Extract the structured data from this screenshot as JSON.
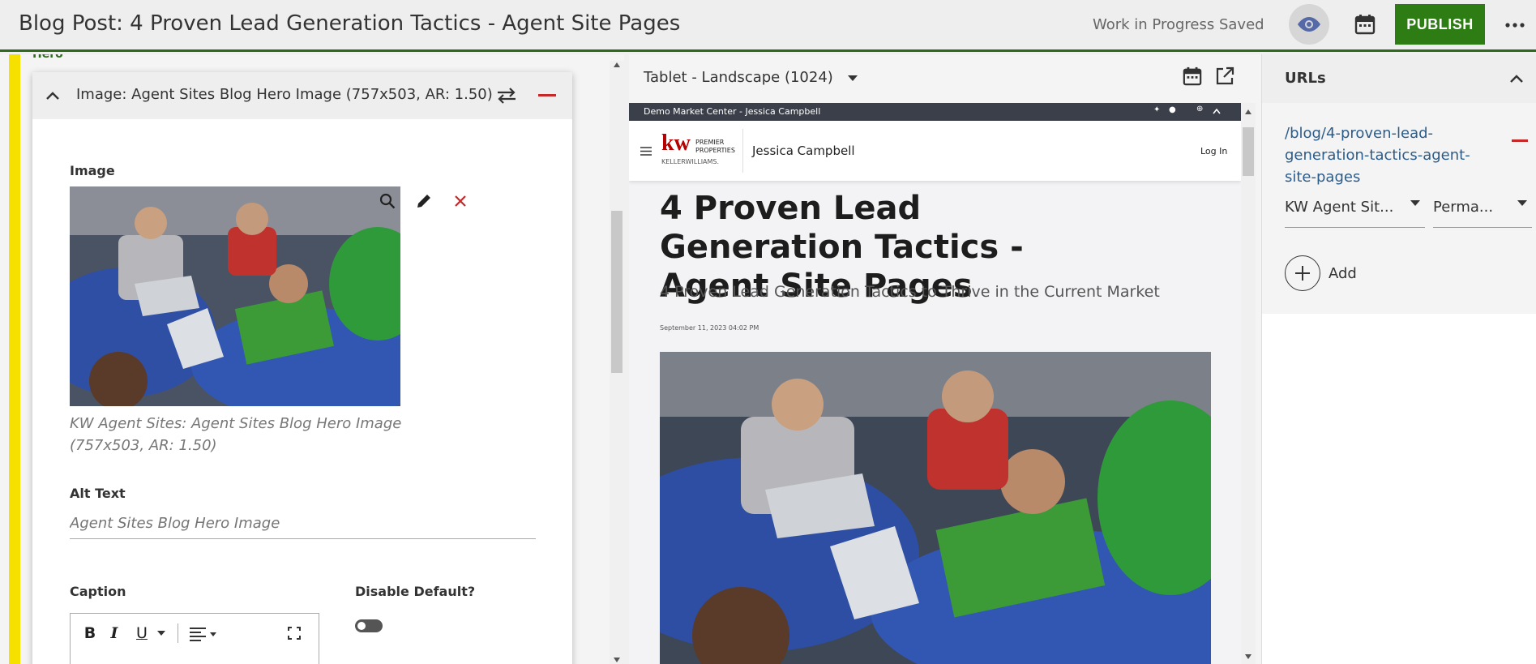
{
  "header": {
    "title": "Blog Post: 4 Proven Lead Generation Tactics - Agent Site Pages",
    "status": "Work in Progress Saved",
    "publish_label": "PUBLISH"
  },
  "editor": {
    "section_label": "Hero",
    "card_title": "Image: Agent Sites Blog Hero Image (757x503, AR: 1.50)",
    "image_label": "Image",
    "image_caption": "KW Agent Sites: Agent Sites Blog Hero Image (757x503, AR: 1.50)",
    "alt_text_label": "Alt Text",
    "alt_text_placeholder": "Agent Sites Blog Hero Image",
    "caption_label": "Caption",
    "disable_default_label": "Disable Default?"
  },
  "preview": {
    "device": "Tablet - Landscape (1024)",
    "site_topbar": "Demo Market Center - Jessica Campbell",
    "agent_name": "Jessica Campbell",
    "login": "Log In",
    "logo_kw": "kw",
    "logo_premier": "PREMIER",
    "logo_properties": "PROPERTIES",
    "logo_keller": "KELLERWILLIAMS.",
    "post_title": "4 Proven Lead Generation Tactics - Agent Site Pages",
    "post_subtitle": "4 Proven Lead Generation Tactics to Thrive in the Current Market",
    "post_date": "September 11, 2023 04:02 PM"
  },
  "urls": {
    "title": "URLs",
    "url": "/blog/4-proven-lead-generation-tactics-agent-site-pages",
    "site_select": "KW Agent Sit...",
    "type_select": "Perma...",
    "add_label": "Add"
  },
  "colors": {
    "accent_green": "#2e7d14",
    "hero_yellow": "#f5e000",
    "danger_red": "#c62828",
    "link_blue": "#2b5c8a"
  }
}
